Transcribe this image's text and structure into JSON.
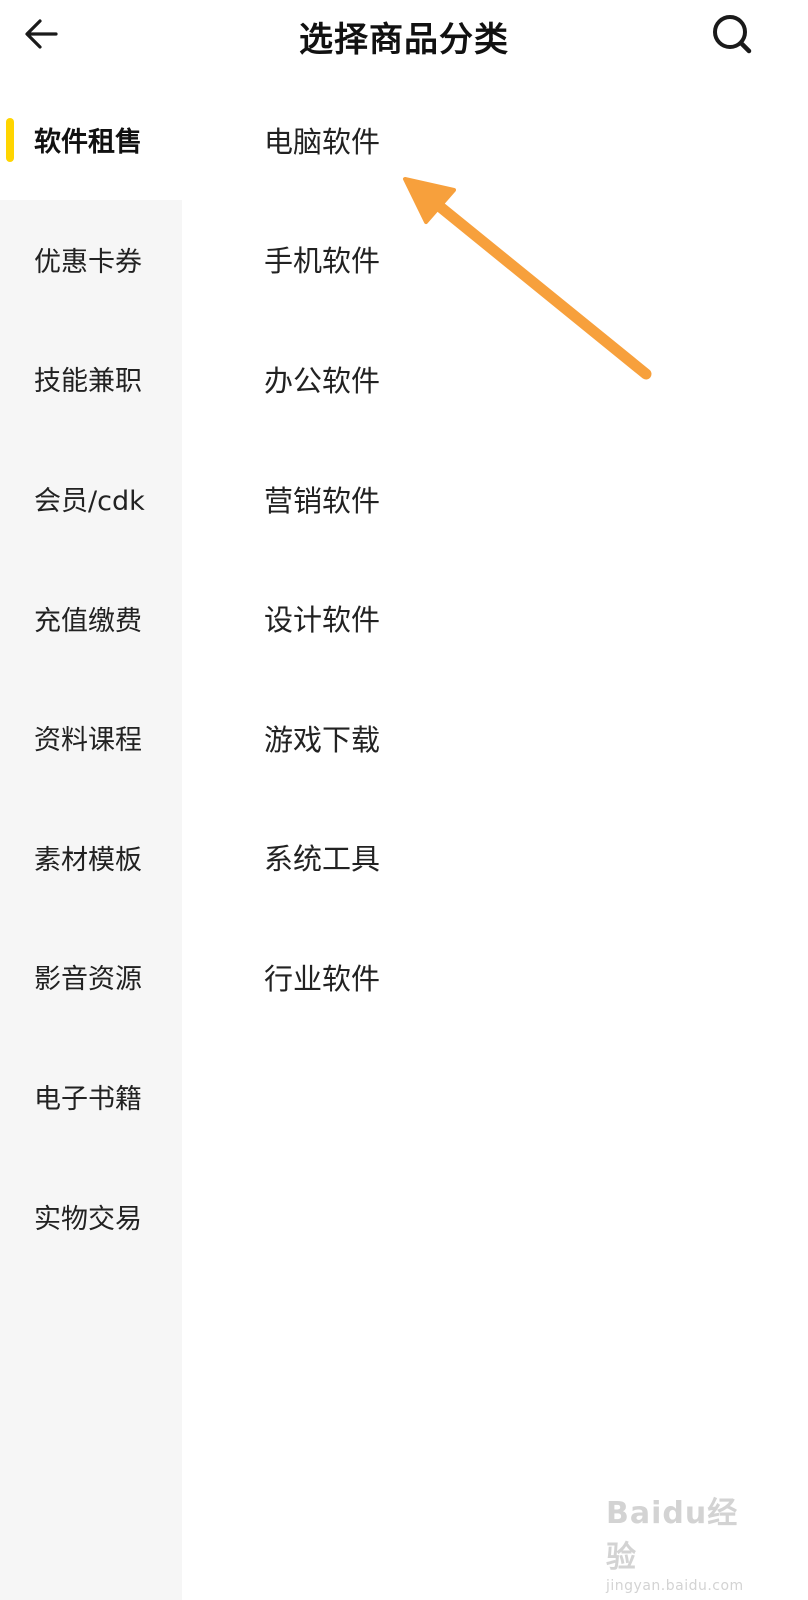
{
  "header": {
    "title": "选择商品分类",
    "back_icon": "arrow-left-icon",
    "search_icon": "search-icon"
  },
  "sidebar": {
    "active_index": 0,
    "accent_color": "#ffd500",
    "items": [
      {
        "label": "软件租售"
      },
      {
        "label": "优惠卡券"
      },
      {
        "label": "技能兼职"
      },
      {
        "label": "会员/cdk"
      },
      {
        "label": "充值缴费"
      },
      {
        "label": "资料课程"
      },
      {
        "label": "素材模板"
      },
      {
        "label": "影音资源"
      },
      {
        "label": "电子书籍"
      },
      {
        "label": "实物交易"
      }
    ]
  },
  "subcategories": {
    "items": [
      {
        "label": "电脑软件"
      },
      {
        "label": "手机软件"
      },
      {
        "label": "办公软件"
      },
      {
        "label": "营销软件"
      },
      {
        "label": "设计软件"
      },
      {
        "label": "游戏下载"
      },
      {
        "label": "系统工具"
      },
      {
        "label": "行业软件"
      }
    ]
  },
  "annotation": {
    "arrow_color": "#f7a03c"
  },
  "watermark": {
    "logo": "Baidu经验",
    "url": "jingyan.baidu.com"
  }
}
